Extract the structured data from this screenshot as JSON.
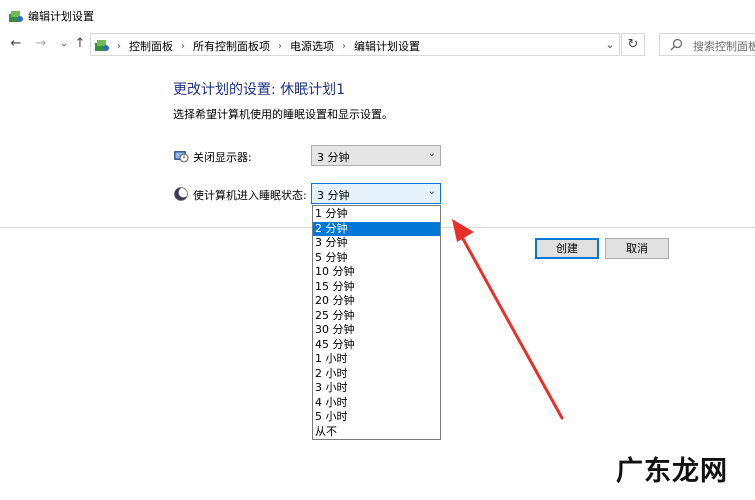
{
  "window": {
    "title": "编辑计划设置"
  },
  "address": {
    "breadcrumbs": [
      "控制面板",
      "所有控制面板项",
      "电源选项",
      "编辑计划设置"
    ],
    "search_placeholder": "搜索控制面板"
  },
  "main": {
    "heading": "更改计划的设置: 休眠计划1",
    "subtitle": "选择希望计算机使用的睡眠设置和显示设置。",
    "display_off": {
      "label": "关闭显示器:",
      "value": "3 分钟"
    },
    "sleep": {
      "label": "使计算机进入睡眠状态:",
      "value": "3 分钟"
    },
    "create_label": "创建",
    "cancel_label": "取消"
  },
  "dropdown": {
    "options": [
      "1 分钟",
      "2 分钟",
      "3 分钟",
      "5 分钟",
      "10 分钟",
      "15 分钟",
      "20 分钟",
      "25 分钟",
      "30 分钟",
      "45 分钟",
      "1 小时",
      "2 小时",
      "3 小时",
      "4 小时",
      "5 小时",
      "从不"
    ],
    "highlighted": "2 分钟"
  },
  "annotation": {
    "arrow_color": "#e8302a"
  },
  "watermark": "广东龙网"
}
